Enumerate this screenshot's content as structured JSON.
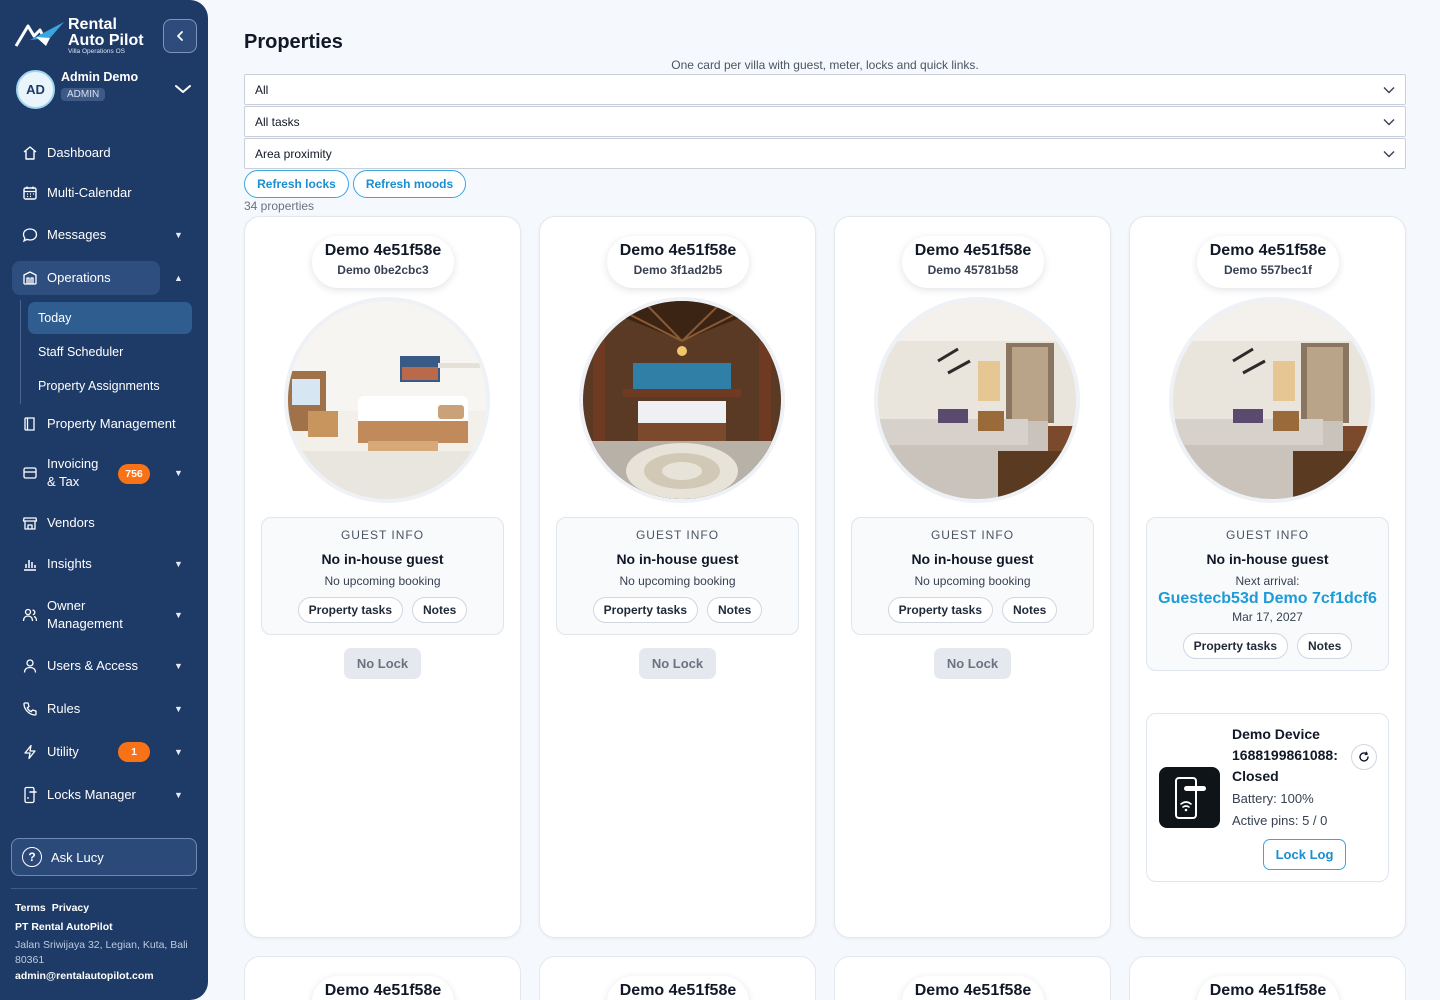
{
  "brand": {
    "line1": "Rental",
    "line2": "Auto Pilot",
    "tagline": "Villa Operations OS"
  },
  "user": {
    "initials": "AD",
    "name": "Admin Demo",
    "role": "ADMIN"
  },
  "nav": {
    "dashboard": "Dashboard",
    "multi_calendar": "Multi-Calendar",
    "messages": "Messages",
    "operations": "Operations",
    "ops_today": "Today",
    "ops_staff": "Staff Scheduler",
    "ops_assign": "Property Assignments",
    "property_management": "Property Management",
    "invoicing_1": "Invoicing",
    "invoicing_2": "& Tax",
    "invoicing_badge": "756",
    "vendors": "Vendors",
    "insights": "Insights",
    "owner_1": "Owner",
    "owner_2": "Management",
    "users": "Users & Access",
    "rules": "Rules",
    "utility": "Utility",
    "utility_badge": "1",
    "locks": "Locks Manager"
  },
  "ask_lucy": "Ask Lucy",
  "footer": {
    "terms": "Terms",
    "privacy": "Privacy",
    "company": "PT Rental AutoPilot",
    "address": "Jalan Sriwijaya 32, Legian, Kuta, Bali 80361",
    "email": "admin@rentalautopilot.com"
  },
  "page": {
    "title": "Properties",
    "subtitle": "One card per villa with guest, meter, locks and quick links.",
    "filter_status": "All",
    "filter_tasks": "All tasks",
    "filter_area": "Area proximity",
    "refresh_locks": "Refresh locks",
    "refresh_moods": "Refresh moods",
    "count": "34 properties"
  },
  "guest_labels": {
    "heading": "GUEST INFO",
    "no_guest": "No in-house guest",
    "no_booking": "No upcoming booking",
    "next_arrival": "Next arrival:",
    "property_tasks": "Property tasks",
    "notes": "Notes",
    "no_lock": "No Lock"
  },
  "cards": [
    {
      "title": "Demo 4e51f58e",
      "subtitle": "Demo 0be2cbc3"
    },
    {
      "title": "Demo 4e51f58e",
      "subtitle": "Demo 3f1ad2b5"
    },
    {
      "title": "Demo 4e51f58e",
      "subtitle": "Demo 45781b58"
    },
    {
      "title": "Demo 4e51f58e",
      "subtitle": "Demo 557bec1f",
      "guest_name": "Guestecb53d Demo 7cf1dcf6",
      "arrival_date": "Mar 17, 2027",
      "lock": {
        "name": "Demo Device 1688199861088: Closed",
        "battery": "Battery: 100%",
        "pins": "Active pins: 5 / 0",
        "log": "Lock Log"
      }
    }
  ],
  "next_row_titles": [
    "Demo 4e51f58e",
    "Demo 4e51f58e",
    "Demo 4e51f58e",
    "Demo 4e51f58e"
  ]
}
